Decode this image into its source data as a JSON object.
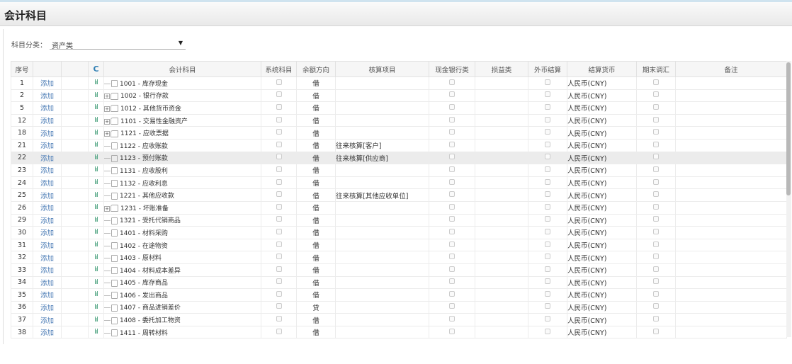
{
  "title": "会计科目",
  "filter": {
    "label": "科目分类：",
    "value": "资产类"
  },
  "headers": {
    "no": "序号",
    "subject": "会计科目",
    "system": "系统科目",
    "direction": "余额方向",
    "accounting": "核算项目",
    "cash": "现金银行类",
    "pl": "损益类",
    "fx": "外币结算",
    "currency": "结算货币",
    "adjust": "期末调汇",
    "remark": "备注"
  },
  "add_label": "添加",
  "rows": [
    {
      "no": "1",
      "subject": "1001 - 库存现金",
      "folder": false,
      "dir": "借",
      "acc": "",
      "cur": "人民币(CNY)"
    },
    {
      "no": "2",
      "subject": "1002 - 银行存款",
      "folder": true,
      "dir": "借",
      "acc": "",
      "cur": "人民币(CNY)"
    },
    {
      "no": "5",
      "subject": "1012 - 其他货币资金",
      "folder": true,
      "dir": "借",
      "acc": "",
      "cur": "人民币(CNY)"
    },
    {
      "no": "12",
      "subject": "1101 - 交易性金融资产",
      "folder": true,
      "dir": "借",
      "acc": "",
      "cur": "人民币(CNY)"
    },
    {
      "no": "18",
      "subject": "1121 - 应收票据",
      "folder": true,
      "dir": "借",
      "acc": "",
      "cur": "人民币(CNY)"
    },
    {
      "no": "21",
      "subject": "1122 - 应收账款",
      "folder": false,
      "dir": "借",
      "acc": "往来核算[客户]",
      "cur": "人民币(CNY)"
    },
    {
      "no": "22",
      "subject": "1123 - 预付账款",
      "folder": false,
      "dir": "借",
      "acc": "往来核算[供应商]",
      "cur": "人民币(CNY)",
      "highlight": true
    },
    {
      "no": "23",
      "subject": "1131 - 应收股利",
      "folder": false,
      "dir": "借",
      "acc": "",
      "cur": "人民币(CNY)"
    },
    {
      "no": "24",
      "subject": "1132 - 应收利息",
      "folder": false,
      "dir": "借",
      "acc": "",
      "cur": "人民币(CNY)"
    },
    {
      "no": "25",
      "subject": "1221 - 其他应收款",
      "folder": false,
      "dir": "借",
      "acc": "往来核算[其他应收单位]",
      "cur": "人民币(CNY)"
    },
    {
      "no": "26",
      "subject": "1231 - 坏账准备",
      "folder": true,
      "dir": "借",
      "acc": "",
      "cur": "人民币(CNY)"
    },
    {
      "no": "29",
      "subject": "1321 - 受托代销商品",
      "folder": false,
      "dir": "借",
      "acc": "",
      "cur": "人民币(CNY)"
    },
    {
      "no": "30",
      "subject": "1401 - 材料采购",
      "folder": false,
      "dir": "借",
      "acc": "",
      "cur": "人民币(CNY)"
    },
    {
      "no": "31",
      "subject": "1402 - 在途物资",
      "folder": false,
      "dir": "借",
      "acc": "",
      "cur": "人民币(CNY)"
    },
    {
      "no": "32",
      "subject": "1403 - 原材料",
      "folder": false,
      "dir": "借",
      "acc": "",
      "cur": "人民币(CNY)"
    },
    {
      "no": "33",
      "subject": "1404 - 材料成本差异",
      "folder": false,
      "dir": "借",
      "acc": "",
      "cur": "人民币(CNY)"
    },
    {
      "no": "34",
      "subject": "1405 - 库存商品",
      "folder": false,
      "dir": "借",
      "acc": "",
      "cur": "人民币(CNY)"
    },
    {
      "no": "35",
      "subject": "1406 - 发出商品",
      "folder": false,
      "dir": "借",
      "acc": "",
      "cur": "人民币(CNY)"
    },
    {
      "no": "36",
      "subject": "1407 - 商品进销差价",
      "folder": false,
      "dir": "贷",
      "acc": "",
      "cur": "人民币(CNY)"
    },
    {
      "no": "37",
      "subject": "1408 - 委托加工物资",
      "folder": false,
      "dir": "借",
      "acc": "",
      "cur": "人民币(CNY)"
    },
    {
      "no": "38",
      "subject": "1411 - 周转材料",
      "folder": false,
      "dir": "借",
      "acc": "",
      "cur": "人民币(CNY)"
    }
  ]
}
